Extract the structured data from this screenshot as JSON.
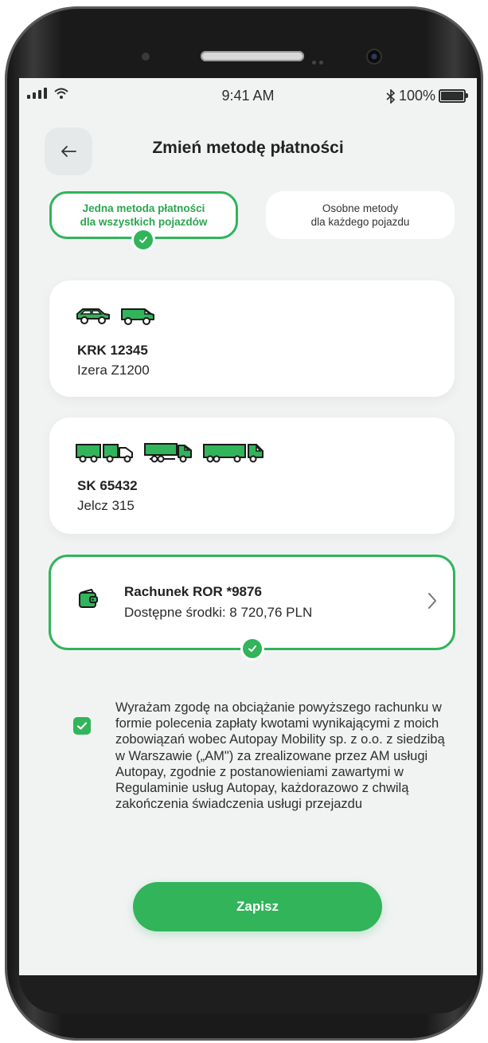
{
  "status_bar": {
    "time": "9:41 AM",
    "battery": "100%"
  },
  "header": {
    "title": "Zmień metodę płatności"
  },
  "payment_mode": {
    "option_single_line1": "Jedna metoda płatności",
    "option_single_line2": "dla wszystkich pojazdów",
    "option_separate_line1": "Osobne metody",
    "option_separate_line2": "dla każdego pojazdu",
    "selected": "single"
  },
  "vehicles": [
    {
      "plate": "KRK 12345",
      "model": "Izera Z1200"
    },
    {
      "plate": "SK 65432",
      "model": "Jelcz 315"
    }
  ],
  "account": {
    "name": "Rachunek ROR *9876",
    "balance": "Dostępne środki: 8 720,76 PLN"
  },
  "consent": {
    "checked": true,
    "text": "Wyrażam zgodę na obciążanie powyższego rachunku w formie polecenia zapłaty kwotami wynikającymi z moich zobowiązań wobec Autopay Mobility sp. z o.o. z siedzibą w Warszawie („AM\") za zrealizowane przez AM usługi Autopay, zgodnie z postanowieniami zawartymi w Regulaminie usług Autopay, każdorazowo z chwilą zakończenia świadczenia usługi przejazdu"
  },
  "actions": {
    "save_label": "Zapisz"
  },
  "colors": {
    "accent": "#31b45a",
    "background": "#f1f3f3",
    "card": "#ffffff"
  }
}
